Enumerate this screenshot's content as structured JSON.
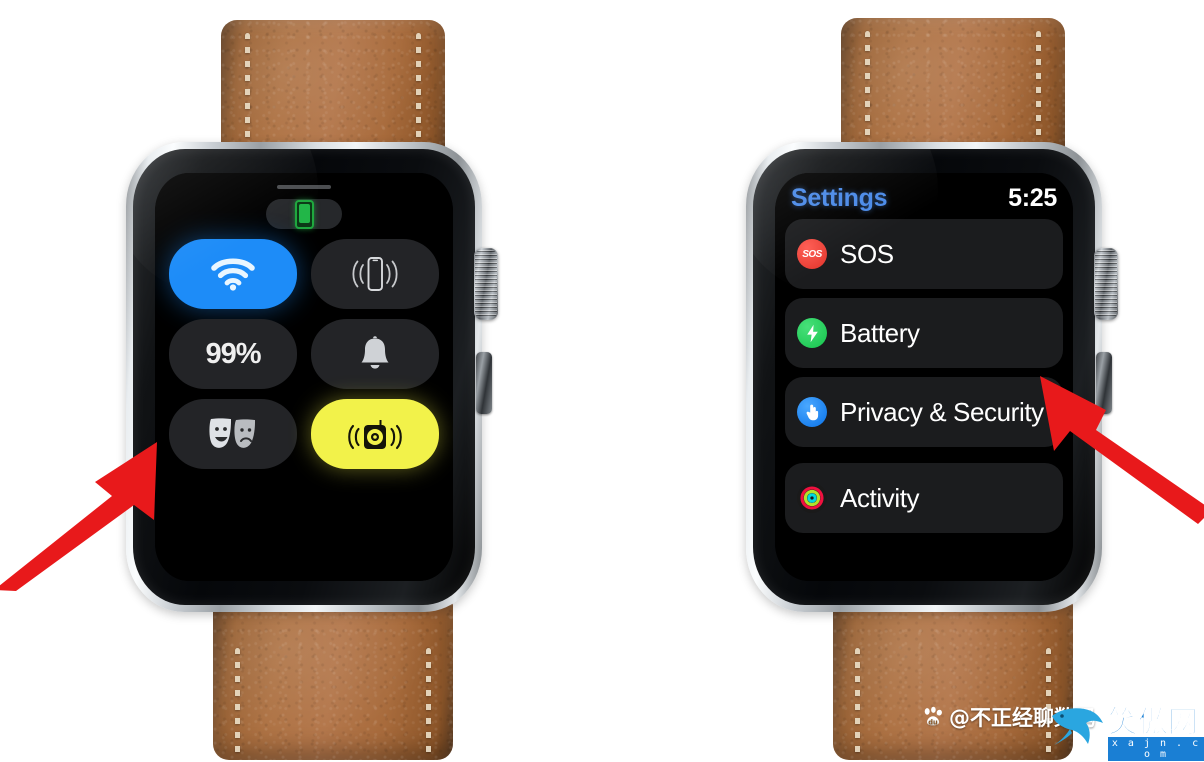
{
  "page": {
    "background_color": "#ffffff",
    "description": "Two Apple Watch photos side by side on white background"
  },
  "left_watch": {
    "screen_name": "Control Center",
    "status_icon": "phone-connected-icon",
    "buttons": [
      {
        "name": "wifi-toggle",
        "icon": "wifi-icon",
        "label": "",
        "state": "on",
        "bg": "#1d8cf8"
      },
      {
        "name": "ping-iphone",
        "icon": "ping-iphone-icon",
        "label": "",
        "state": "off",
        "bg": "#232427"
      },
      {
        "name": "battery-percentage",
        "icon": "battery-icon",
        "label": "99%",
        "state": "off",
        "bg": "#232427"
      },
      {
        "name": "silent-mode",
        "icon": "bell-icon",
        "label": "",
        "state": "off",
        "bg": "#232427"
      },
      {
        "name": "theater-mode",
        "icon": "theater-masks-icon",
        "label": "",
        "state": "off",
        "bg": "#232427"
      },
      {
        "name": "walkie-talkie",
        "icon": "walkie-talkie-icon",
        "label": "",
        "state": "on",
        "bg": "#f2f24a"
      }
    ]
  },
  "right_watch": {
    "screen_name": "Settings",
    "header": {
      "title": "Settings",
      "title_color": "#4a8ae8",
      "time": "5:25"
    },
    "rows": [
      {
        "label": "SOS",
        "icon": "sos-icon",
        "icon_color": "#e0332a",
        "clipped": false
      },
      {
        "label": "Battery",
        "icon": "battery-bolt-icon",
        "icon_color": "#15c44c",
        "clipped": false
      },
      {
        "label": "Privacy & Security",
        "icon": "privacy-hand-icon",
        "icon_color": "#0a72e8",
        "clipped": false
      },
      {
        "label": "Activity",
        "icon": "activity-rings-icon",
        "icon_color": "#e8113f",
        "clipped": true
      }
    ]
  },
  "annotations": {
    "arrow_color": "#e8191b",
    "arrows": [
      {
        "name": "arrow-to-battery-percentage",
        "points_to": "99%"
      },
      {
        "name": "arrow-to-battery-row",
        "points_to": "Battery"
      }
    ]
  },
  "watermarks": {
    "baidu": {
      "handle": "@不正经聊数码",
      "icon": "baidu-paw-icon"
    },
    "xajn": {
      "site_name": "笑傲网",
      "domain": "x a j n . c o m",
      "icon": "dolphin-icon"
    }
  }
}
